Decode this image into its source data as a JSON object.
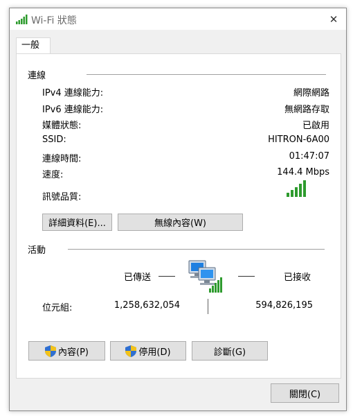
{
  "window": {
    "title": "Wi-Fi 狀態",
    "close_symbol": "✕"
  },
  "tabs": [
    {
      "label": "一般"
    }
  ],
  "connection": {
    "header": "連線",
    "rows": [
      {
        "label": "IPv4 連線能力:",
        "value": "網際網路"
      },
      {
        "label": "IPv6 連線能力:",
        "value": "無網路存取"
      },
      {
        "label": "媒體狀態:",
        "value": "已啟用"
      },
      {
        "label": "SSID:",
        "value": "HITRON-6A00"
      },
      {
        "label": "連線時間:",
        "value": "01:47:07"
      },
      {
        "label": "速度:",
        "value": "144.4 Mbps"
      }
    ],
    "signal_label": "訊號品質:",
    "signal_bars_filled": 5,
    "details_button": "詳細資料(E)...",
    "wireless_button": "無線內容(W)"
  },
  "activity": {
    "header": "活動",
    "sent_label": "已傳送",
    "received_label": "已接收",
    "bytes_label": "位元組:",
    "bytes_sent": "1,258,632,054",
    "bytes_received": "594,826,195"
  },
  "actions": {
    "properties": "內容(P)",
    "disable": "停用(D)",
    "diagnose": "診斷(G)"
  },
  "footer": {
    "close_button": "關閉(C)"
  },
  "colors": {
    "signal_green": "#2e9b2e",
    "shield_blue": "#2f6fd0",
    "shield_yellow": "#f2c21b"
  }
}
